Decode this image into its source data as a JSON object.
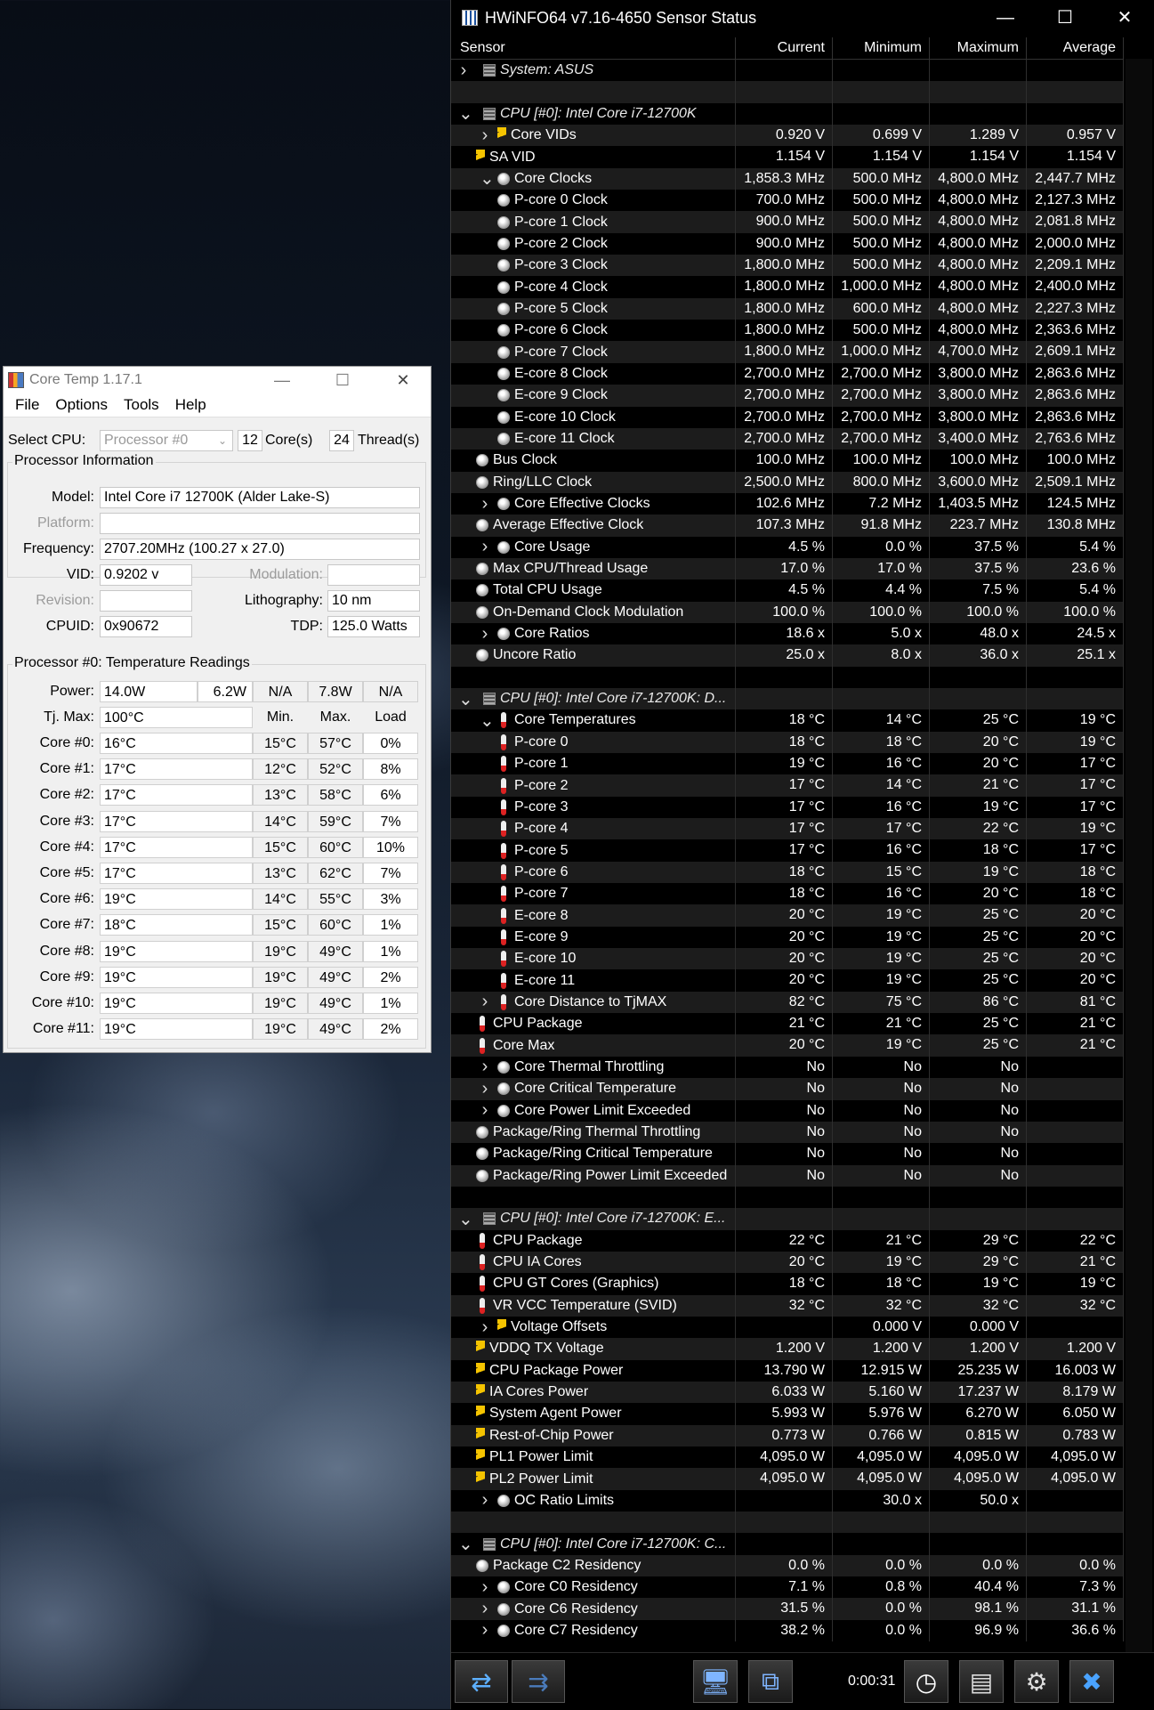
{
  "coretemp": {
    "title": "Core Temp 1.17.1",
    "menu": [
      "File",
      "Options",
      "Tools",
      "Help"
    ],
    "select_cpu_label": "Select CPU:",
    "select_cpu_value": "Processor #0",
    "cores_value": "12",
    "cores_label": "Core(s)",
    "threads_value": "24",
    "threads_label": "Thread(s)",
    "proc_info_title": "Processor Information",
    "model_label": "Model:",
    "model_value": "Intel Core i7 12700K (Alder Lake-S)",
    "platform_label": "Platform:",
    "frequency_label": "Frequency:",
    "frequency_value": "2707.20MHz (100.27 x 27.0)",
    "vid_label": "VID:",
    "vid_value": "0.9202 v",
    "modulation_label": "Modulation:",
    "revision_label": "Revision:",
    "lithography_label": "Lithography:",
    "lithography_value": "10 nm",
    "cpuid_label": "CPUID:",
    "cpuid_value": "0x90672",
    "tdp_label": "TDP:",
    "tdp_value": "125.0 Watts",
    "temp_title": "Processor #0: Temperature Readings",
    "power_label": "Power:",
    "power_values": [
      "14.0W",
      "6.2W",
      "N/A",
      "7.8W",
      "N/A"
    ],
    "tjmax_label": "Tj. Max:",
    "tjmax_value": "100°C",
    "col_min": "Min.",
    "col_max": "Max.",
    "col_load": "Load",
    "cores": [
      {
        "name": "Core #0:",
        "temp": "16°C",
        "min": "15°C",
        "max": "57°C",
        "load": "0%"
      },
      {
        "name": "Core #1:",
        "temp": "17°C",
        "min": "12°C",
        "max": "52°C",
        "load": "8%"
      },
      {
        "name": "Core #2:",
        "temp": "17°C",
        "min": "13°C",
        "max": "58°C",
        "load": "6%"
      },
      {
        "name": "Core #3:",
        "temp": "17°C",
        "min": "14°C",
        "max": "59°C",
        "load": "7%"
      },
      {
        "name": "Core #4:",
        "temp": "17°C",
        "min": "15°C",
        "max": "60°C",
        "load": "10%"
      },
      {
        "name": "Core #5:",
        "temp": "17°C",
        "min": "13°C",
        "max": "62°C",
        "load": "7%"
      },
      {
        "name": "Core #6:",
        "temp": "19°C",
        "min": "14°C",
        "max": "55°C",
        "load": "3%"
      },
      {
        "name": "Core #7:",
        "temp": "18°C",
        "min": "15°C",
        "max": "60°C",
        "load": "1%"
      },
      {
        "name": "Core #8:",
        "temp": "19°C",
        "min": "19°C",
        "max": "49°C",
        "load": "1%"
      },
      {
        "name": "Core #9:",
        "temp": "19°C",
        "min": "19°C",
        "max": "49°C",
        "load": "2%"
      },
      {
        "name": "Core #10:",
        "temp": "19°C",
        "min": "19°C",
        "max": "49°C",
        "load": "1%"
      },
      {
        "name": "Core #11:",
        "temp": "19°C",
        "min": "19°C",
        "max": "49°C",
        "load": "2%"
      }
    ]
  },
  "hwinfo": {
    "title": "HWiNFO64 v7.16-4650 Sensor Status",
    "columns": [
      "Sensor",
      "Current",
      "Minimum",
      "Maximum",
      "Average"
    ],
    "timer": "0:00:31",
    "rows": [
      {
        "l": "System: ASUS",
        "i": "chip",
        "e": ">",
        "d": 0,
        "it": true,
        "v": [
          "",
          "",
          "",
          ""
        ]
      },
      {
        "l": "",
        "i": "",
        "e": "",
        "d": 0,
        "v": [
          "",
          "",
          "",
          ""
        ]
      },
      {
        "l": "CPU [#0]: Intel Core i7-12700K",
        "i": "chip",
        "e": "v",
        "d": 0,
        "it": true,
        "v": [
          "",
          "",
          "",
          ""
        ]
      },
      {
        "l": "Core VIDs",
        "i": "volt",
        "e": ">",
        "d": 2,
        "v": [
          "0.920 V",
          "0.699 V",
          "1.289 V",
          "0.957 V"
        ]
      },
      {
        "l": "SA VID",
        "i": "volt",
        "e": "",
        "d": 1,
        "v": [
          "1.154 V",
          "1.154 V",
          "1.154 V",
          "1.154 V"
        ]
      },
      {
        "l": "Core Clocks",
        "i": "clock",
        "e": "v",
        "d": 2,
        "v": [
          "1,858.3 MHz",
          "500.0 MHz",
          "4,800.0 MHz",
          "2,447.7 MHz"
        ]
      },
      {
        "l": "P-core 0 Clock",
        "i": "clock",
        "e": "",
        "d": 2,
        "v": [
          "700.0 MHz",
          "500.0 MHz",
          "4,800.0 MHz",
          "2,127.3 MHz"
        ]
      },
      {
        "l": "P-core 1 Clock",
        "i": "clock",
        "e": "",
        "d": 2,
        "v": [
          "900.0 MHz",
          "500.0 MHz",
          "4,800.0 MHz",
          "2,081.8 MHz"
        ]
      },
      {
        "l": "P-core 2 Clock",
        "i": "clock",
        "e": "",
        "d": 2,
        "v": [
          "900.0 MHz",
          "500.0 MHz",
          "4,800.0 MHz",
          "2,000.0 MHz"
        ]
      },
      {
        "l": "P-core 3 Clock",
        "i": "clock",
        "e": "",
        "d": 2,
        "v": [
          "1,800.0 MHz",
          "500.0 MHz",
          "4,800.0 MHz",
          "2,209.1 MHz"
        ]
      },
      {
        "l": "P-core 4 Clock",
        "i": "clock",
        "e": "",
        "d": 2,
        "v": [
          "1,800.0 MHz",
          "1,000.0 MHz",
          "4,800.0 MHz",
          "2,400.0 MHz"
        ]
      },
      {
        "l": "P-core 5 Clock",
        "i": "clock",
        "e": "",
        "d": 2,
        "v": [
          "1,800.0 MHz",
          "600.0 MHz",
          "4,800.0 MHz",
          "2,227.3 MHz"
        ]
      },
      {
        "l": "P-core 6 Clock",
        "i": "clock",
        "e": "",
        "d": 2,
        "v": [
          "1,800.0 MHz",
          "500.0 MHz",
          "4,800.0 MHz",
          "2,363.6 MHz"
        ]
      },
      {
        "l": "P-core 7 Clock",
        "i": "clock",
        "e": "",
        "d": 2,
        "v": [
          "1,800.0 MHz",
          "1,000.0 MHz",
          "4,700.0 MHz",
          "2,609.1 MHz"
        ]
      },
      {
        "l": "E-core 8 Clock",
        "i": "clock",
        "e": "",
        "d": 2,
        "v": [
          "2,700.0 MHz",
          "2,700.0 MHz",
          "3,800.0 MHz",
          "2,863.6 MHz"
        ]
      },
      {
        "l": "E-core 9 Clock",
        "i": "clock",
        "e": "",
        "d": 2,
        "v": [
          "2,700.0 MHz",
          "2,700.0 MHz",
          "3,800.0 MHz",
          "2,863.6 MHz"
        ]
      },
      {
        "l": "E-core 10 Clock",
        "i": "clock",
        "e": "",
        "d": 2,
        "v": [
          "2,700.0 MHz",
          "2,700.0 MHz",
          "3,800.0 MHz",
          "2,863.6 MHz"
        ]
      },
      {
        "l": "E-core 11 Clock",
        "i": "clock",
        "e": "",
        "d": 2,
        "v": [
          "2,700.0 MHz",
          "2,700.0 MHz",
          "3,400.0 MHz",
          "2,763.6 MHz"
        ]
      },
      {
        "l": "Bus Clock",
        "i": "clock",
        "e": "",
        "d": 1,
        "v": [
          "100.0 MHz",
          "100.0 MHz",
          "100.0 MHz",
          "100.0 MHz"
        ]
      },
      {
        "l": "Ring/LLC Clock",
        "i": "clock",
        "e": "",
        "d": 1,
        "v": [
          "2,500.0 MHz",
          "800.0 MHz",
          "3,600.0 MHz",
          "2,509.1 MHz"
        ]
      },
      {
        "l": "Core Effective Clocks",
        "i": "clock",
        "e": ">",
        "d": 2,
        "v": [
          "102.6 MHz",
          "7.2 MHz",
          "1,403.5 MHz",
          "124.5 MHz"
        ]
      },
      {
        "l": "Average Effective Clock",
        "i": "clock",
        "e": "",
        "d": 1,
        "v": [
          "107.3 MHz",
          "91.8 MHz",
          "223.7 MHz",
          "130.8 MHz"
        ]
      },
      {
        "l": "Core Usage",
        "i": "clock",
        "e": ">",
        "d": 2,
        "v": [
          "4.5 %",
          "0.0 %",
          "37.5 %",
          "5.4 %"
        ]
      },
      {
        "l": "Max CPU/Thread Usage",
        "i": "clock",
        "e": "",
        "d": 1,
        "v": [
          "17.0 %",
          "17.0 %",
          "37.5 %",
          "23.6 %"
        ]
      },
      {
        "l": "Total CPU Usage",
        "i": "clock",
        "e": "",
        "d": 1,
        "v": [
          "4.5 %",
          "4.4 %",
          "7.5 %",
          "5.4 %"
        ]
      },
      {
        "l": "On-Demand Clock Modulation",
        "i": "clock",
        "e": "",
        "d": 1,
        "v": [
          "100.0 %",
          "100.0 %",
          "100.0 %",
          "100.0 %"
        ]
      },
      {
        "l": "Core Ratios",
        "i": "clock",
        "e": ">",
        "d": 2,
        "v": [
          "18.6 x",
          "5.0 x",
          "48.0 x",
          "24.5 x"
        ]
      },
      {
        "l": "Uncore Ratio",
        "i": "clock",
        "e": "",
        "d": 1,
        "v": [
          "25.0 x",
          "8.0 x",
          "36.0 x",
          "25.1 x"
        ]
      },
      {
        "l": "",
        "i": "",
        "e": "",
        "d": 0,
        "v": [
          "",
          "",
          "",
          ""
        ]
      },
      {
        "l": "CPU [#0]: Intel Core i7-12700K: D...",
        "i": "chip",
        "e": "v",
        "d": 0,
        "it": true,
        "v": [
          "",
          "",
          "",
          ""
        ]
      },
      {
        "l": "Core Temperatures",
        "i": "temp",
        "e": "v",
        "d": 2,
        "v": [
          "18 °C",
          "14 °C",
          "25 °C",
          "19 °C"
        ]
      },
      {
        "l": "P-core 0",
        "i": "temp",
        "e": "",
        "d": 2,
        "v": [
          "18 °C",
          "18 °C",
          "20 °C",
          "19 °C"
        ]
      },
      {
        "l": "P-core 1",
        "i": "temp",
        "e": "",
        "d": 2,
        "v": [
          "19 °C",
          "16 °C",
          "20 °C",
          "17 °C"
        ]
      },
      {
        "l": "P-core 2",
        "i": "temp",
        "e": "",
        "d": 2,
        "v": [
          "17 °C",
          "14 °C",
          "21 °C",
          "17 °C"
        ]
      },
      {
        "l": "P-core 3",
        "i": "temp",
        "e": "",
        "d": 2,
        "v": [
          "17 °C",
          "16 °C",
          "19 °C",
          "17 °C"
        ]
      },
      {
        "l": "P-core 4",
        "i": "temp",
        "e": "",
        "d": 2,
        "v": [
          "17 °C",
          "17 °C",
          "22 °C",
          "19 °C"
        ]
      },
      {
        "l": "P-core 5",
        "i": "temp",
        "e": "",
        "d": 2,
        "v": [
          "17 °C",
          "16 °C",
          "18 °C",
          "17 °C"
        ]
      },
      {
        "l": "P-core 6",
        "i": "temp",
        "e": "",
        "d": 2,
        "v": [
          "18 °C",
          "15 °C",
          "19 °C",
          "18 °C"
        ]
      },
      {
        "l": "P-core 7",
        "i": "temp",
        "e": "",
        "d": 2,
        "v": [
          "18 °C",
          "16 °C",
          "20 °C",
          "18 °C"
        ]
      },
      {
        "l": "E-core 8",
        "i": "temp",
        "e": "",
        "d": 2,
        "v": [
          "20 °C",
          "19 °C",
          "25 °C",
          "20 °C"
        ]
      },
      {
        "l": "E-core 9",
        "i": "temp",
        "e": "",
        "d": 2,
        "v": [
          "20 °C",
          "19 °C",
          "25 °C",
          "20 °C"
        ]
      },
      {
        "l": "E-core 10",
        "i": "temp",
        "e": "",
        "d": 2,
        "v": [
          "20 °C",
          "19 °C",
          "25 °C",
          "20 °C"
        ]
      },
      {
        "l": "E-core 11",
        "i": "temp",
        "e": "",
        "d": 2,
        "v": [
          "20 °C",
          "19 °C",
          "25 °C",
          "20 °C"
        ]
      },
      {
        "l": "Core Distance to TjMAX",
        "i": "temp",
        "e": ">",
        "d": 2,
        "v": [
          "82 °C",
          "75 °C",
          "86 °C",
          "81 °C"
        ]
      },
      {
        "l": "CPU Package",
        "i": "temp",
        "e": "",
        "d": 1,
        "v": [
          "21 °C",
          "21 °C",
          "25 °C",
          "21 °C"
        ]
      },
      {
        "l": "Core Max",
        "i": "temp",
        "e": "",
        "d": 1,
        "v": [
          "20 °C",
          "19 °C",
          "25 °C",
          "21 °C"
        ]
      },
      {
        "l": "Core Thermal Throttling",
        "i": "clock",
        "e": ">",
        "d": 2,
        "v": [
          "No",
          "No",
          "No",
          ""
        ]
      },
      {
        "l": "Core Critical Temperature",
        "i": "clock",
        "e": ">",
        "d": 2,
        "v": [
          "No",
          "No",
          "No",
          ""
        ]
      },
      {
        "l": "Core Power Limit Exceeded",
        "i": "clock",
        "e": ">",
        "d": 2,
        "v": [
          "No",
          "No",
          "No",
          ""
        ]
      },
      {
        "l": "Package/Ring Thermal Throttling",
        "i": "clock",
        "e": "",
        "d": 1,
        "v": [
          "No",
          "No",
          "No",
          ""
        ]
      },
      {
        "l": "Package/Ring Critical Temperature",
        "i": "clock",
        "e": "",
        "d": 1,
        "v": [
          "No",
          "No",
          "No",
          ""
        ]
      },
      {
        "l": "Package/Ring Power Limit Exceeded",
        "i": "clock",
        "e": "",
        "d": 1,
        "v": [
          "No",
          "No",
          "No",
          ""
        ]
      },
      {
        "l": "",
        "i": "",
        "e": "",
        "d": 0,
        "v": [
          "",
          "",
          "",
          ""
        ]
      },
      {
        "l": "CPU [#0]: Intel Core i7-12700K: E...",
        "i": "chip",
        "e": "v",
        "d": 0,
        "it": true,
        "v": [
          "",
          "",
          "",
          ""
        ]
      },
      {
        "l": "CPU Package",
        "i": "temp",
        "e": "",
        "d": 1,
        "v": [
          "22 °C",
          "21 °C",
          "29 °C",
          "22 °C"
        ]
      },
      {
        "l": "CPU IA Cores",
        "i": "temp",
        "e": "",
        "d": 1,
        "v": [
          "20 °C",
          "19 °C",
          "29 °C",
          "21 °C"
        ]
      },
      {
        "l": "CPU GT Cores (Graphics)",
        "i": "temp",
        "e": "",
        "d": 1,
        "v": [
          "18 °C",
          "18 °C",
          "19 °C",
          "19 °C"
        ]
      },
      {
        "l": "VR VCC Temperature (SVID)",
        "i": "temp",
        "e": "",
        "d": 1,
        "v": [
          "32 °C",
          "32 °C",
          "32 °C",
          "32 °C"
        ]
      },
      {
        "l": "Voltage Offsets",
        "i": "volt",
        "e": ">",
        "d": 2,
        "v": [
          "",
          "0.000 V",
          "0.000 V",
          ""
        ]
      },
      {
        "l": "VDDQ TX Voltage",
        "i": "volt",
        "e": "",
        "d": 1,
        "v": [
          "1.200 V",
          "1.200 V",
          "1.200 V",
          "1.200 V"
        ]
      },
      {
        "l": "CPU Package Power",
        "i": "volt",
        "e": "",
        "d": 1,
        "v": [
          "13.790 W",
          "12.915 W",
          "25.235 W",
          "16.003 W"
        ]
      },
      {
        "l": "IA Cores Power",
        "i": "volt",
        "e": "",
        "d": 1,
        "v": [
          "6.033 W",
          "5.160 W",
          "17.237 W",
          "8.179 W"
        ]
      },
      {
        "l": "System Agent Power",
        "i": "volt",
        "e": "",
        "d": 1,
        "v": [
          "5.993 W",
          "5.976 W",
          "6.270 W",
          "6.050 W"
        ]
      },
      {
        "l": "Rest-of-Chip Power",
        "i": "volt",
        "e": "",
        "d": 1,
        "v": [
          "0.773 W",
          "0.766 W",
          "0.815 W",
          "0.783 W"
        ]
      },
      {
        "l": "PL1 Power Limit",
        "i": "volt",
        "e": "",
        "d": 1,
        "v": [
          "4,095.0 W",
          "4,095.0 W",
          "4,095.0 W",
          "4,095.0 W"
        ]
      },
      {
        "l": "PL2 Power Limit",
        "i": "volt",
        "e": "",
        "d": 1,
        "v": [
          "4,095.0 W",
          "4,095.0 W",
          "4,095.0 W",
          "4,095.0 W"
        ]
      },
      {
        "l": "OC Ratio Limits",
        "i": "clock",
        "e": ">",
        "d": 2,
        "v": [
          "",
          "30.0 x",
          "50.0 x",
          ""
        ]
      },
      {
        "l": "",
        "i": "",
        "e": "",
        "d": 0,
        "v": [
          "",
          "",
          "",
          ""
        ]
      },
      {
        "l": "CPU [#0]: Intel Core i7-12700K: C...",
        "i": "chip",
        "e": "v",
        "d": 0,
        "it": true,
        "v": [
          "",
          "",
          "",
          ""
        ]
      },
      {
        "l": "Package C2 Residency",
        "i": "clock",
        "e": "",
        "d": 1,
        "v": [
          "0.0 %",
          "0.0 %",
          "0.0 %",
          "0.0 %"
        ]
      },
      {
        "l": "Core C0 Residency",
        "i": "clock",
        "e": ">",
        "d": 2,
        "v": [
          "7.1 %",
          "0.8 %",
          "40.4 %",
          "7.3 %"
        ]
      },
      {
        "l": "Core C6 Residency",
        "i": "clock",
        "e": ">",
        "d": 2,
        "v": [
          "31.5 %",
          "0.0 %",
          "98.1 %",
          "31.1 %"
        ]
      },
      {
        "l": "Core C7 Residency",
        "i": "clock",
        "e": ">",
        "d": 2,
        "v": [
          "38.2 %",
          "0.0 %",
          "96.9 %",
          "36.6 %"
        ]
      }
    ]
  }
}
